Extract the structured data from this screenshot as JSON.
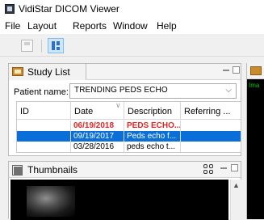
{
  "app": {
    "title": "VidiStar DICOM Viewer"
  },
  "menu": {
    "items": [
      "File",
      "Layout",
      "Reports",
      "Window",
      "Help"
    ]
  },
  "toolbar": {
    "save_icon": "save-icon",
    "layout_icon": "layout-icon"
  },
  "study_list": {
    "title": "Study List",
    "patient_label": "Patient name:",
    "patient_value": "TRENDING PEDS ECHO",
    "columns": [
      "ID",
      "Date",
      "Description",
      "Referring ..."
    ],
    "rows": [
      {
        "id": "",
        "date": "06/19/2018",
        "description": "PEDS ECHO..."
      },
      {
        "id": "",
        "date": "09/19/2017",
        "description": "Peds echo f..."
      },
      {
        "id": "",
        "date": "03/28/2016",
        "description": "peds echo t..."
      }
    ]
  },
  "thumbnails": {
    "title": "Thumbnails"
  },
  "right_panel": {
    "text": "Ima"
  },
  "colors": {
    "selected_row": "#0a6fd8",
    "highlight_text": "#e22626",
    "overlay_text": "#00c800"
  }
}
